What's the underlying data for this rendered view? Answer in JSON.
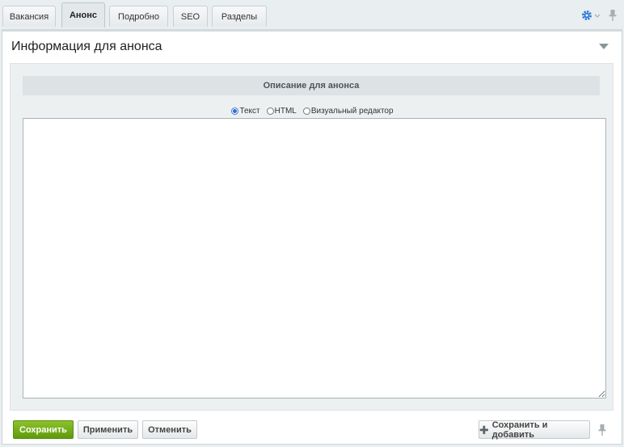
{
  "tabs": [
    {
      "label": "Вакансия",
      "active": false
    },
    {
      "label": "Анонс",
      "active": true
    },
    {
      "label": "Подробно",
      "active": false
    },
    {
      "label": "SEO",
      "active": false
    },
    {
      "label": "Разделы",
      "active": false
    }
  ],
  "panel": {
    "title": "Информация для анонса",
    "section_header": "Описание для анонса",
    "editor_modes": [
      {
        "label": "Текст",
        "checked": true
      },
      {
        "label": "HTML",
        "checked": false
      },
      {
        "label": "Визуальный редактор",
        "checked": false
      }
    ],
    "textarea_value": ""
  },
  "buttons": {
    "save": "Сохранить",
    "apply": "Применить",
    "cancel": "Отменить",
    "save_and_add": "Сохранить и добавить"
  },
  "colors": {
    "accent_blue": "#2f6ed4",
    "save_green": "#6aa61a",
    "background": "#e9eef0"
  },
  "icons": {
    "settings": "gear-icon",
    "pin": "pin-icon",
    "collapse": "triangle-down-icon",
    "add": "plus-icon"
  }
}
